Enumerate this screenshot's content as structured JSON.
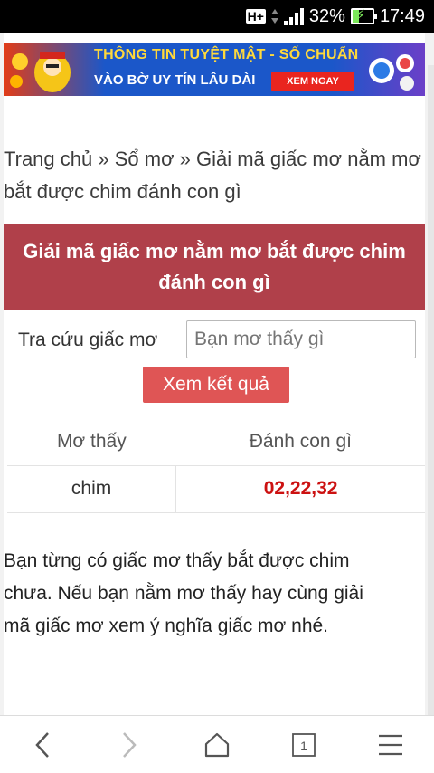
{
  "status_bar": {
    "network": "H+",
    "battery_percent": "32%",
    "time": "17:49"
  },
  "banner": {
    "headline": "THÔNG TIN TUYỆT MẬT - SỐ CHUẨN",
    "subline": "VÀO BỜ UY TÍN LÂU DÀI",
    "cta": "XEM NGAY"
  },
  "breadcrumb": {
    "home": "Trang chủ",
    "sep1": " » ",
    "section": "Sổ mơ",
    "sep2": " » ",
    "current": "Giải mã giấc mơ nằm mơ bắt được chim đánh con gì"
  },
  "title": "Giải mã giấc mơ nằm mơ bắt được chim đánh con gì",
  "search": {
    "label": "Tra cứu giấc mơ",
    "placeholder": "Bạn mơ thấy gì",
    "button": "Xem kết quả"
  },
  "results": {
    "headers": [
      "Mơ thấy",
      "Đánh con gì"
    ],
    "rows": [
      {
        "dream": "chim",
        "numbers": "02,22,32"
      }
    ]
  },
  "paragraph": "Bạn từng có giấc mơ thấy bắt được chim chưa. Nếu bạn nằm mơ thấy hay cùng giải mã giấc mơ xem ý nghĩa giấc mơ nhé.",
  "bottom_nav": {
    "tabs_count": "1",
    "icons": [
      "back-icon",
      "forward-icon",
      "home-icon",
      "tabs-icon",
      "menu-icon"
    ]
  },
  "colors": {
    "title_bg": "#b0404a",
    "button_bg": "#df5555",
    "number_color": "#cc1111"
  }
}
